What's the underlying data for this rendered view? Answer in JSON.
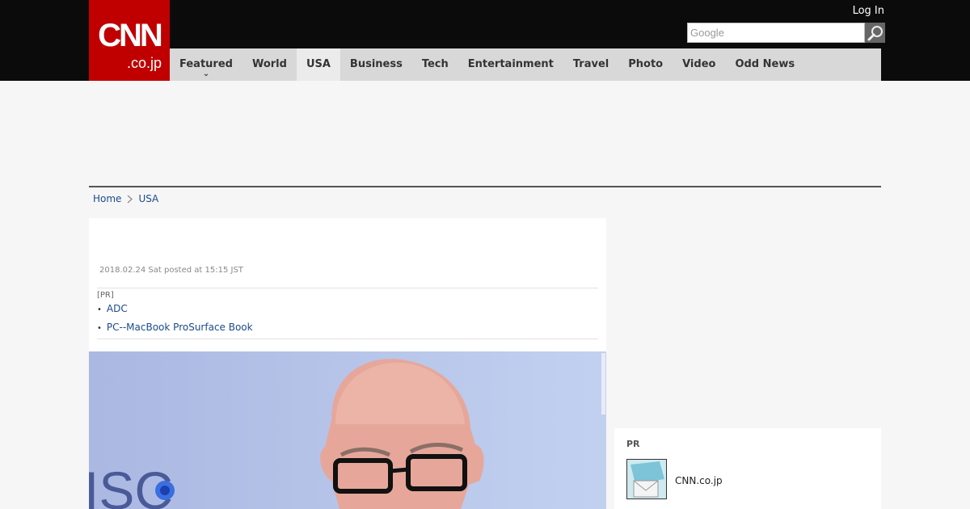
{
  "header": {
    "logo_main": "CNN",
    "logo_sub": ".co.jp",
    "login_label": "Log In",
    "search_placeholder": "Google"
  },
  "nav": {
    "items": [
      {
        "label": "Featured"
      },
      {
        "label": "World"
      },
      {
        "label": "USA"
      },
      {
        "label": "Business"
      },
      {
        "label": "Tech"
      },
      {
        "label": "Entertainment"
      },
      {
        "label": "Travel"
      },
      {
        "label": "Photo"
      },
      {
        "label": "Video"
      },
      {
        "label": "Odd News"
      }
    ],
    "active": "USA"
  },
  "breadcrumb": {
    "home": "Home",
    "current": "USA"
  },
  "article": {
    "date": "2018.02.24 Sat posted at 15:15 JST",
    "pr_label": "[PR]",
    "pr_links": [
      "ADC",
      "PC--MacBook ProSurface Book"
    ]
  },
  "sidebar_pr": {
    "label": "PR",
    "item_text": "CNN.co.jp"
  },
  "icons": {
    "search": "search-icon",
    "caret": "chevron-down-icon",
    "breadcrumb_sep": "chevron-right-icon"
  },
  "colors": {
    "brand_red": "#c00000",
    "header_bg": "#0b0b0b",
    "nav_bg": "#d8d8d8",
    "link": "#1a4b8c"
  }
}
